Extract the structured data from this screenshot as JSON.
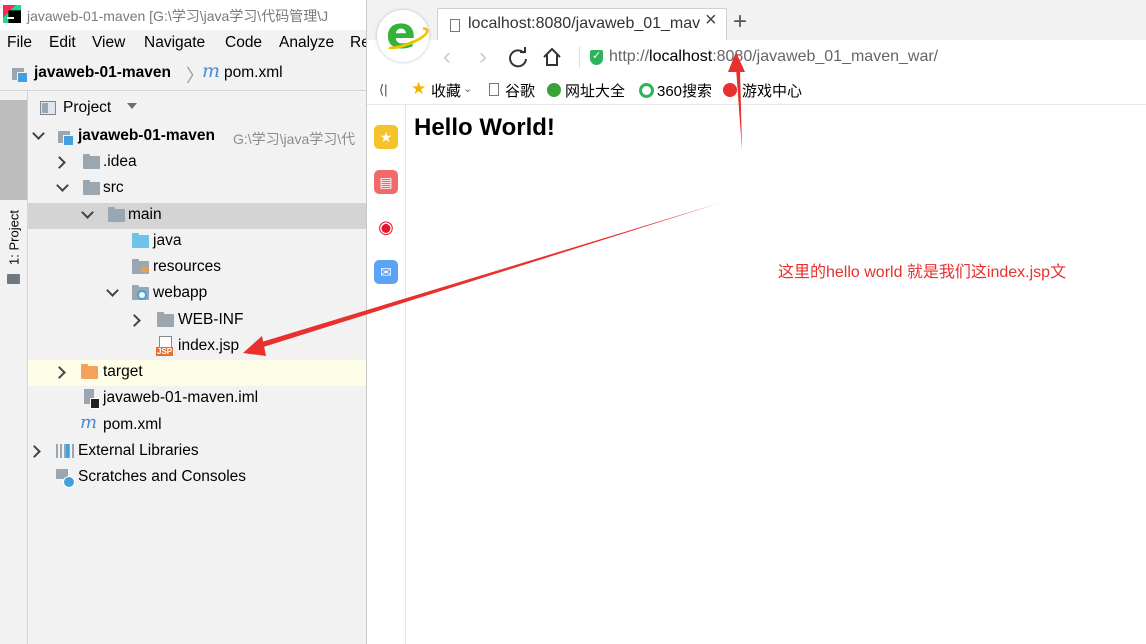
{
  "ide": {
    "window_title": "javaweb-01-maven [G:\\学习\\java学习\\代码管理\\J",
    "menu": [
      "File",
      "Edit",
      "View",
      "Navigate",
      "Code",
      "Analyze",
      "Re"
    ],
    "breadcrumb": {
      "project": "javaweb-01-maven",
      "file": "pom.xml",
      "m_glyph": "m"
    },
    "side_tab": "1: Project",
    "panel_title": "Project",
    "tree": {
      "root": {
        "label": "javaweb-01-maven",
        "path": "G:\\学习\\java学习\\代"
      },
      "idea": ".idea",
      "src": "src",
      "main": "main",
      "java": "java",
      "resources": "resources",
      "webapp": "webapp",
      "webinf": "WEB-INF",
      "indexjsp": "index.jsp",
      "target": "target",
      "iml": "javaweb-01-maven.iml",
      "pom": "pom.xml",
      "extlibs": "External Libraries",
      "scratches": "Scratches and Consoles"
    }
  },
  "browser": {
    "tab_title": "localhost:8080/javaweb_01_mav",
    "tab_close": "×",
    "tab_new": "+",
    "url": {
      "prefix": "http://",
      "host": "localhost",
      "rest": ":8080/javaweb_01_maven_war/"
    },
    "bookmarks_toggle": "⟨|",
    "bookmarks": [
      "收藏",
      "谷歌",
      "网址大全",
      "360搜索",
      "游戏中心"
    ],
    "page_heading": "Hello World!"
  },
  "annotation": "这里的hello world 就是我们这index.jsp文",
  "colors": {
    "annotation": "#e8302c",
    "selected_row": "#d4d4d4",
    "highlight_row": "#fefee8",
    "ie_green": "#33b33a"
  }
}
